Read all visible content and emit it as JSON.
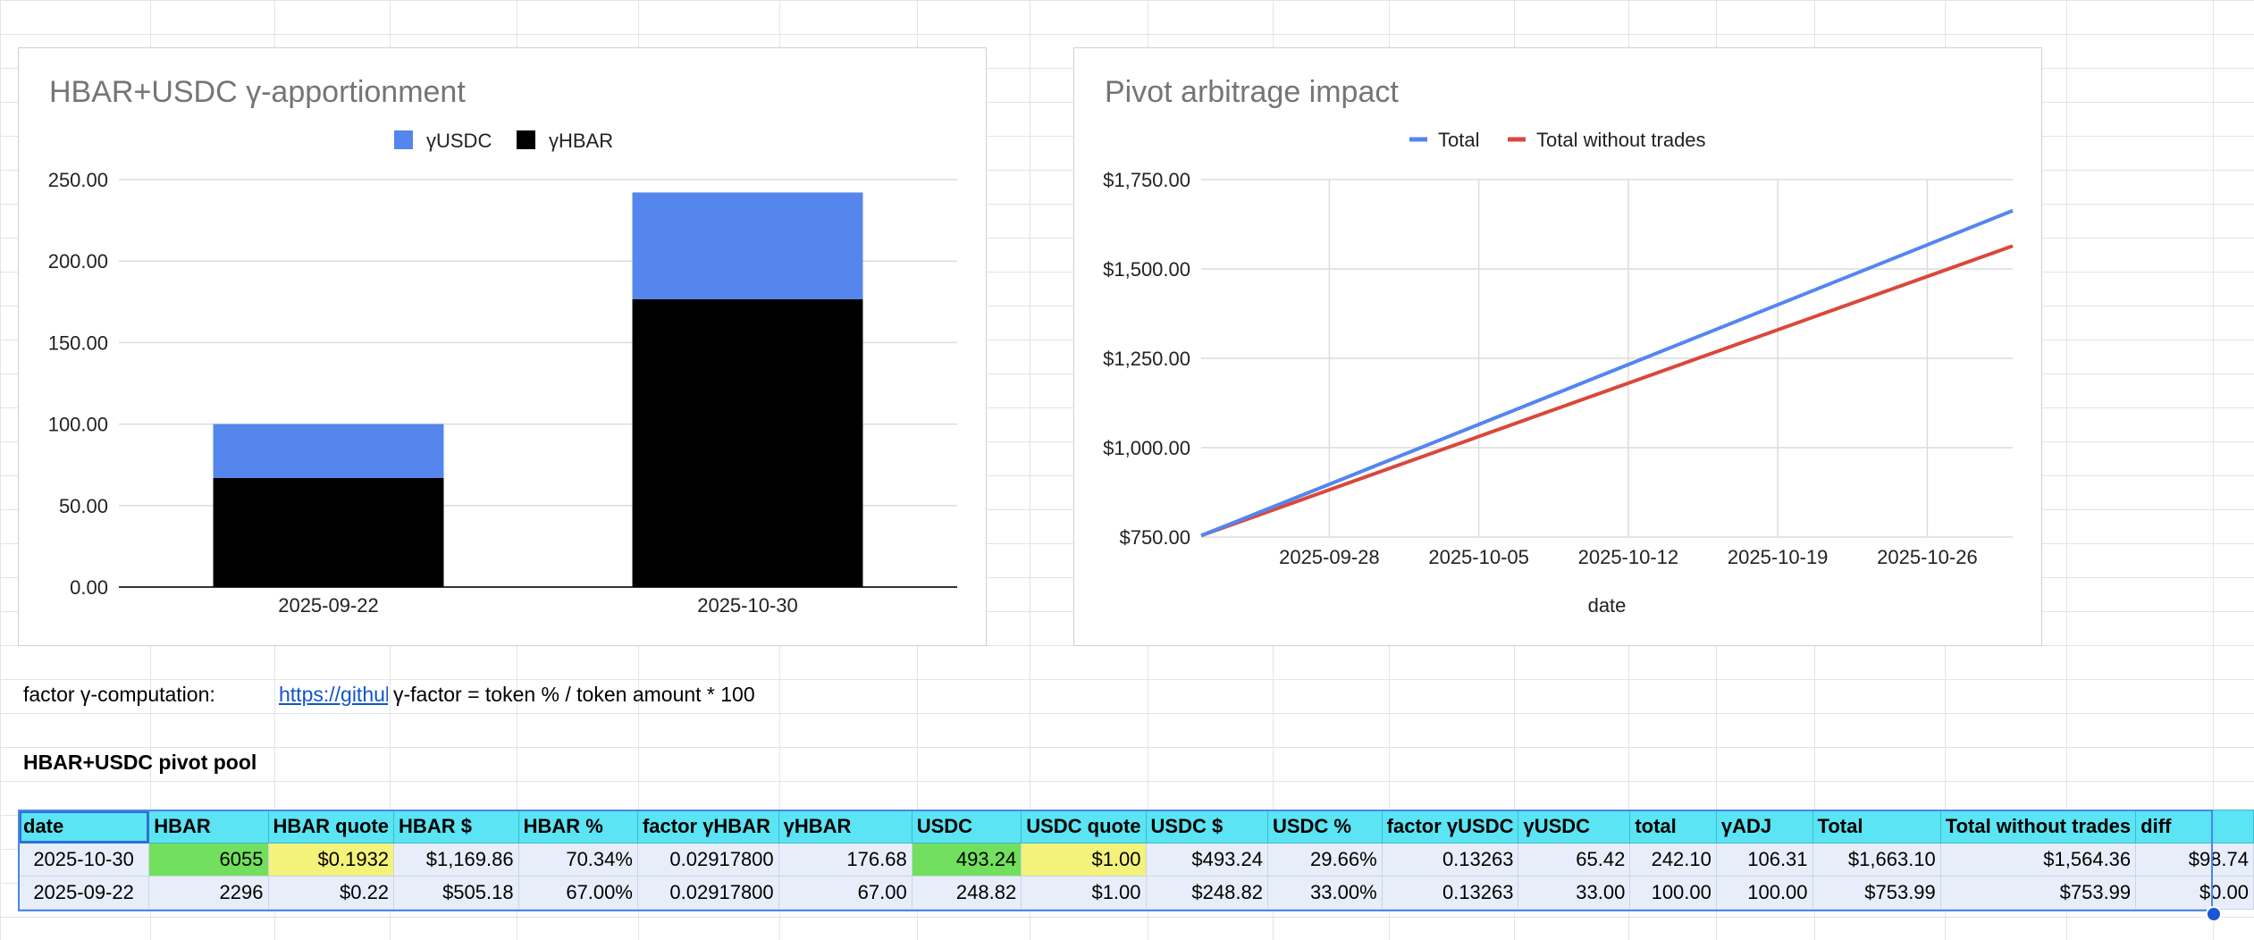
{
  "charts": {
    "apportionment": {
      "title": "HBAR+USDC γ-apportionment",
      "legend": [
        "γUSDC",
        "γHBAR"
      ]
    },
    "arbitrage": {
      "title": "Pivot arbitrage impact",
      "legend": [
        "Total",
        "Total without trades"
      ],
      "xlabel": "date"
    }
  },
  "colors": {
    "usdc": "#5486ee",
    "hbar": "#000000",
    "total": "#5486ee",
    "total_without": "#d9483b",
    "header": "#5ae4f4"
  },
  "chart_data": [
    {
      "type": "bar",
      "stacked": true,
      "title": "HBAR+USDC γ-apportionment",
      "categories": [
        "2025-09-22",
        "2025-10-30"
      ],
      "series": [
        {
          "name": "γHBAR",
          "values": [
            67.0,
            176.68
          ]
        },
        {
          "name": "γUSDC",
          "values": [
            33.0,
            65.42
          ]
        }
      ],
      "ylim": [
        0,
        250
      ],
      "yticks": [
        "0.00",
        "50.00",
        "100.00",
        "150.00",
        "200.00",
        "250.00"
      ],
      "legend": "top-center",
      "grid": true
    },
    {
      "type": "line",
      "title": "Pivot arbitrage impact",
      "xlabel": "date",
      "x": [
        "2025-09-22",
        "2025-10-30"
      ],
      "series": [
        {
          "name": "Total",
          "values": [
            753.99,
            1663.1
          ]
        },
        {
          "name": "Total without trades",
          "values": [
            753.99,
            1564.36
          ]
        }
      ],
      "ylim": [
        750,
        1750
      ],
      "yticks": [
        "$750.00",
        "$1,000.00",
        "$1,250.00",
        "$1,500.00",
        "$1,750.00"
      ],
      "xticks": [
        "2025-09-28",
        "2025-10-05",
        "2025-10-12",
        "2025-10-19",
        "2025-10-26"
      ],
      "legend": "top-center",
      "grid": true
    }
  ],
  "notes": {
    "factor_label": "factor γ-computation:",
    "link_text": "https://github",
    "formula": "γ-factor = token % / token amount * 100",
    "pool_title": "HBAR+USDC pivot pool"
  },
  "table": {
    "headers": [
      "date",
      "HBAR",
      "HBAR quote",
      "HBAR $",
      "HBAR %",
      "factor γHBAR",
      "γHBAR",
      "USDC",
      "USDC quote",
      "USDC $",
      "USDC %",
      "factor γUSDC",
      "γUSDC",
      "total",
      "γADJ",
      "Total",
      "Total without trades",
      "diff"
    ],
    "rows": [
      [
        "2025-10-30",
        "6055",
        "$0.1932",
        "$1,169.86",
        "70.34%",
        "0.02917800",
        "176.68",
        "493.24",
        "$1.00",
        "$493.24",
        "29.66%",
        "0.13263",
        "65.42",
        "242.10",
        "106.31",
        "$1,663.10",
        "$1,564.36",
        "$98.74"
      ],
      [
        "2025-09-22",
        "2296",
        "$0.22",
        "$505.18",
        "67.00%",
        "0.02917800",
        "67.00",
        "248.82",
        "$1.00",
        "$248.82",
        "33.00%",
        "0.13263",
        "33.00",
        "100.00",
        "100.00",
        "$753.99",
        "$753.99",
        "$0.00"
      ]
    ]
  }
}
